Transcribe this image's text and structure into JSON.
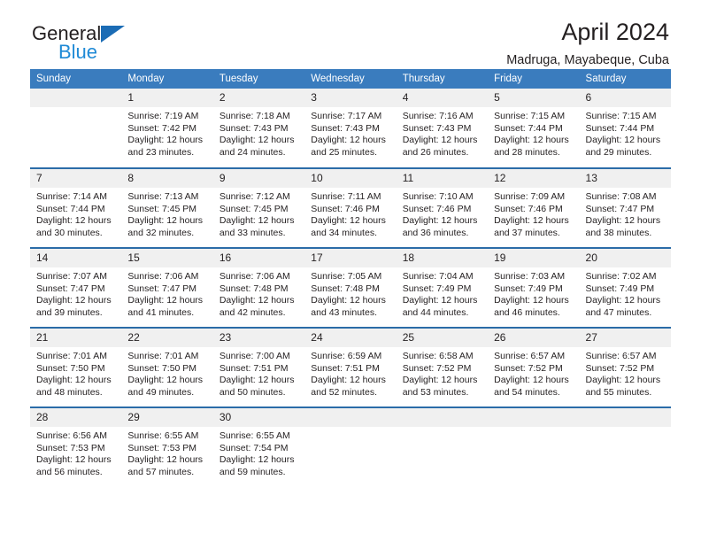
{
  "logo": {
    "word_one": "General",
    "word_two": "Blue",
    "triangle": "triangle-icon",
    "accent_color": "#1b6cb5",
    "blue_text_color": "#1f8ad6"
  },
  "header": {
    "title": "April 2024",
    "subtitle": "Madruga, Mayabeque, Cuba"
  },
  "table": {
    "header_bg": "#3a7cbe",
    "row_divider": "#2b6ca8",
    "daynum_bg": "#f0f0f0",
    "columns": [
      "Sunday",
      "Monday",
      "Tuesday",
      "Wednesday",
      "Thursday",
      "Friday",
      "Saturday"
    ]
  },
  "labels": {
    "sunrise": "Sunrise:",
    "sunset": "Sunset:",
    "daylight": "Daylight:"
  },
  "weeks": [
    [
      {
        "day": "",
        "sunrise": "",
        "sunset": "",
        "daylight_line1": "",
        "daylight_line2": ""
      },
      {
        "day": "1",
        "sunrise": "Sunrise: 7:19 AM",
        "sunset": "Sunset: 7:42 PM",
        "daylight_line1": "Daylight: 12 hours",
        "daylight_line2": "and 23 minutes."
      },
      {
        "day": "2",
        "sunrise": "Sunrise: 7:18 AM",
        "sunset": "Sunset: 7:43 PM",
        "daylight_line1": "Daylight: 12 hours",
        "daylight_line2": "and 24 minutes."
      },
      {
        "day": "3",
        "sunrise": "Sunrise: 7:17 AM",
        "sunset": "Sunset: 7:43 PM",
        "daylight_line1": "Daylight: 12 hours",
        "daylight_line2": "and 25 minutes."
      },
      {
        "day": "4",
        "sunrise": "Sunrise: 7:16 AM",
        "sunset": "Sunset: 7:43 PM",
        "daylight_line1": "Daylight: 12 hours",
        "daylight_line2": "and 26 minutes."
      },
      {
        "day": "5",
        "sunrise": "Sunrise: 7:15 AM",
        "sunset": "Sunset: 7:44 PM",
        "daylight_line1": "Daylight: 12 hours",
        "daylight_line2": "and 28 minutes."
      },
      {
        "day": "6",
        "sunrise": "Sunrise: 7:15 AM",
        "sunset": "Sunset: 7:44 PM",
        "daylight_line1": "Daylight: 12 hours",
        "daylight_line2": "and 29 minutes."
      }
    ],
    [
      {
        "day": "7",
        "sunrise": "Sunrise: 7:14 AM",
        "sunset": "Sunset: 7:44 PM",
        "daylight_line1": "Daylight: 12 hours",
        "daylight_line2": "and 30 minutes."
      },
      {
        "day": "8",
        "sunrise": "Sunrise: 7:13 AM",
        "sunset": "Sunset: 7:45 PM",
        "daylight_line1": "Daylight: 12 hours",
        "daylight_line2": "and 32 minutes."
      },
      {
        "day": "9",
        "sunrise": "Sunrise: 7:12 AM",
        "sunset": "Sunset: 7:45 PM",
        "daylight_line1": "Daylight: 12 hours",
        "daylight_line2": "and 33 minutes."
      },
      {
        "day": "10",
        "sunrise": "Sunrise: 7:11 AM",
        "sunset": "Sunset: 7:46 PM",
        "daylight_line1": "Daylight: 12 hours",
        "daylight_line2": "and 34 minutes."
      },
      {
        "day": "11",
        "sunrise": "Sunrise: 7:10 AM",
        "sunset": "Sunset: 7:46 PM",
        "daylight_line1": "Daylight: 12 hours",
        "daylight_line2": "and 36 minutes."
      },
      {
        "day": "12",
        "sunrise": "Sunrise: 7:09 AM",
        "sunset": "Sunset: 7:46 PM",
        "daylight_line1": "Daylight: 12 hours",
        "daylight_line2": "and 37 minutes."
      },
      {
        "day": "13",
        "sunrise": "Sunrise: 7:08 AM",
        "sunset": "Sunset: 7:47 PM",
        "daylight_line1": "Daylight: 12 hours",
        "daylight_line2": "and 38 minutes."
      }
    ],
    [
      {
        "day": "14",
        "sunrise": "Sunrise: 7:07 AM",
        "sunset": "Sunset: 7:47 PM",
        "daylight_line1": "Daylight: 12 hours",
        "daylight_line2": "and 39 minutes."
      },
      {
        "day": "15",
        "sunrise": "Sunrise: 7:06 AM",
        "sunset": "Sunset: 7:47 PM",
        "daylight_line1": "Daylight: 12 hours",
        "daylight_line2": "and 41 minutes."
      },
      {
        "day": "16",
        "sunrise": "Sunrise: 7:06 AM",
        "sunset": "Sunset: 7:48 PM",
        "daylight_line1": "Daylight: 12 hours",
        "daylight_line2": "and 42 minutes."
      },
      {
        "day": "17",
        "sunrise": "Sunrise: 7:05 AM",
        "sunset": "Sunset: 7:48 PM",
        "daylight_line1": "Daylight: 12 hours",
        "daylight_line2": "and 43 minutes."
      },
      {
        "day": "18",
        "sunrise": "Sunrise: 7:04 AM",
        "sunset": "Sunset: 7:49 PM",
        "daylight_line1": "Daylight: 12 hours",
        "daylight_line2": "and 44 minutes."
      },
      {
        "day": "19",
        "sunrise": "Sunrise: 7:03 AM",
        "sunset": "Sunset: 7:49 PM",
        "daylight_line1": "Daylight: 12 hours",
        "daylight_line2": "and 46 minutes."
      },
      {
        "day": "20",
        "sunrise": "Sunrise: 7:02 AM",
        "sunset": "Sunset: 7:49 PM",
        "daylight_line1": "Daylight: 12 hours",
        "daylight_line2": "and 47 minutes."
      }
    ],
    [
      {
        "day": "21",
        "sunrise": "Sunrise: 7:01 AM",
        "sunset": "Sunset: 7:50 PM",
        "daylight_line1": "Daylight: 12 hours",
        "daylight_line2": "and 48 minutes."
      },
      {
        "day": "22",
        "sunrise": "Sunrise: 7:01 AM",
        "sunset": "Sunset: 7:50 PM",
        "daylight_line1": "Daylight: 12 hours",
        "daylight_line2": "and 49 minutes."
      },
      {
        "day": "23",
        "sunrise": "Sunrise: 7:00 AM",
        "sunset": "Sunset: 7:51 PM",
        "daylight_line1": "Daylight: 12 hours",
        "daylight_line2": "and 50 minutes."
      },
      {
        "day": "24",
        "sunrise": "Sunrise: 6:59 AM",
        "sunset": "Sunset: 7:51 PM",
        "daylight_line1": "Daylight: 12 hours",
        "daylight_line2": "and 52 minutes."
      },
      {
        "day": "25",
        "sunrise": "Sunrise: 6:58 AM",
        "sunset": "Sunset: 7:52 PM",
        "daylight_line1": "Daylight: 12 hours",
        "daylight_line2": "and 53 minutes."
      },
      {
        "day": "26",
        "sunrise": "Sunrise: 6:57 AM",
        "sunset": "Sunset: 7:52 PM",
        "daylight_line1": "Daylight: 12 hours",
        "daylight_line2": "and 54 minutes."
      },
      {
        "day": "27",
        "sunrise": "Sunrise: 6:57 AM",
        "sunset": "Sunset: 7:52 PM",
        "daylight_line1": "Daylight: 12 hours",
        "daylight_line2": "and 55 minutes."
      }
    ],
    [
      {
        "day": "28",
        "sunrise": "Sunrise: 6:56 AM",
        "sunset": "Sunset: 7:53 PM",
        "daylight_line1": "Daylight: 12 hours",
        "daylight_line2": "and 56 minutes."
      },
      {
        "day": "29",
        "sunrise": "Sunrise: 6:55 AM",
        "sunset": "Sunset: 7:53 PM",
        "daylight_line1": "Daylight: 12 hours",
        "daylight_line2": "and 57 minutes."
      },
      {
        "day": "30",
        "sunrise": "Sunrise: 6:55 AM",
        "sunset": "Sunset: 7:54 PM",
        "daylight_line1": "Daylight: 12 hours",
        "daylight_line2": "and 59 minutes."
      },
      {
        "day": "",
        "sunrise": "",
        "sunset": "",
        "daylight_line1": "",
        "daylight_line2": ""
      },
      {
        "day": "",
        "sunrise": "",
        "sunset": "",
        "daylight_line1": "",
        "daylight_line2": ""
      },
      {
        "day": "",
        "sunrise": "",
        "sunset": "",
        "daylight_line1": "",
        "daylight_line2": ""
      },
      {
        "day": "",
        "sunrise": "",
        "sunset": "",
        "daylight_line1": "",
        "daylight_line2": ""
      }
    ]
  ]
}
